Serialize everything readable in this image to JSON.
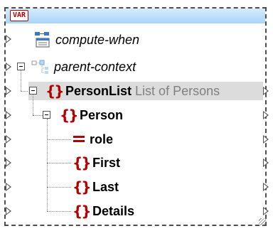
{
  "component": {
    "badge": "VAR",
    "rows": {
      "compute_when": "compute-when",
      "parent_context": "parent-context",
      "personlist_name": "PersonList",
      "personlist_desc": "List of Persons",
      "person": "Person",
      "role": "role",
      "first": "First",
      "last": "Last",
      "details": "Details"
    }
  },
  "colors": {
    "header": "#a9d4f8",
    "element_icon": "#b40000",
    "highlight": "#dcdcdc"
  }
}
